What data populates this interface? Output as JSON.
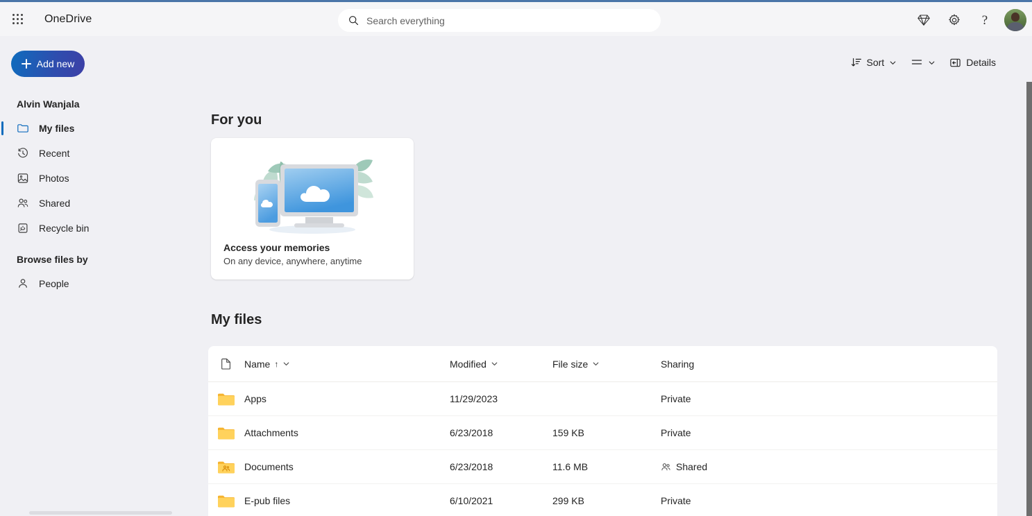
{
  "app": {
    "brand": "OneDrive",
    "waffle_icon": "app-launcher-icon"
  },
  "search": {
    "placeholder": "Search everything",
    "value": "",
    "icon": "search-icon"
  },
  "header_actions": [
    {
      "name": "premium-icon",
      "label": "Premium"
    },
    {
      "name": "gear-icon",
      "label": "Settings"
    },
    {
      "name": "help-icon",
      "label": "?"
    }
  ],
  "account": {
    "avatar_label": "Alvin Wanjala"
  },
  "commandbar": {
    "sort_label": "Sort",
    "sort_icon": "sort-icon",
    "view_icon": "list-view-icon",
    "details_label": "Details",
    "details_icon": "details-pane-icon"
  },
  "sidebar": {
    "add_new_label": "Add new",
    "account_title": "Alvin Wanjala",
    "items": [
      {
        "label": "My files",
        "icon": "folder-icon",
        "selected": true
      },
      {
        "label": "Recent",
        "icon": "clock-icon",
        "selected": false
      },
      {
        "label": "Photos",
        "icon": "photo-icon",
        "selected": false
      },
      {
        "label": "Shared",
        "icon": "people-icon",
        "selected": false
      },
      {
        "label": "Recycle bin",
        "icon": "recycle-bin-icon",
        "selected": false
      }
    ],
    "browse_title": "Browse files by",
    "browse_items": [
      {
        "label": "People",
        "icon": "person-icon"
      }
    ]
  },
  "main": {
    "for_you_heading": "For you",
    "card": {
      "title": "Access your memories",
      "subtitle": "On any device, anywhere, anytime",
      "illustration": "devices-cloud-illustration"
    },
    "my_files_heading": "My files",
    "table": {
      "columns": [
        {
          "key": "name",
          "label": "Name",
          "sorted": "asc"
        },
        {
          "key": "modified",
          "label": "Modified"
        },
        {
          "key": "size",
          "label": "File size"
        },
        {
          "key": "sharing",
          "label": "Sharing"
        }
      ],
      "rows": [
        {
          "name": "Apps",
          "modified": "11/29/2023",
          "size": "",
          "sharing": "Private",
          "icon": "folder-icon",
          "shared": false
        },
        {
          "name": "Attachments",
          "modified": "6/23/2018",
          "size": "159 KB",
          "sharing": "Private",
          "icon": "folder-icon",
          "shared": false
        },
        {
          "name": "Documents",
          "modified": "6/23/2018",
          "size": "11.6 MB",
          "sharing": "Shared",
          "icon": "shared-folder-icon",
          "shared": true
        },
        {
          "name": "E-pub files",
          "modified": "6/10/2021",
          "size": "299 KB",
          "sharing": "Private",
          "icon": "folder-icon",
          "shared": false
        }
      ]
    }
  },
  "colors": {
    "accent": "#0f6cbd",
    "add_new_gradient_start": "#0f6cbd",
    "add_new_gradient_end": "#3d3fa6",
    "page_bg": "#f0f0f4",
    "header_bg": "#f5f5f7",
    "folder_yellow": "#ffd25c",
    "top_strip": "#4a75a8"
  }
}
